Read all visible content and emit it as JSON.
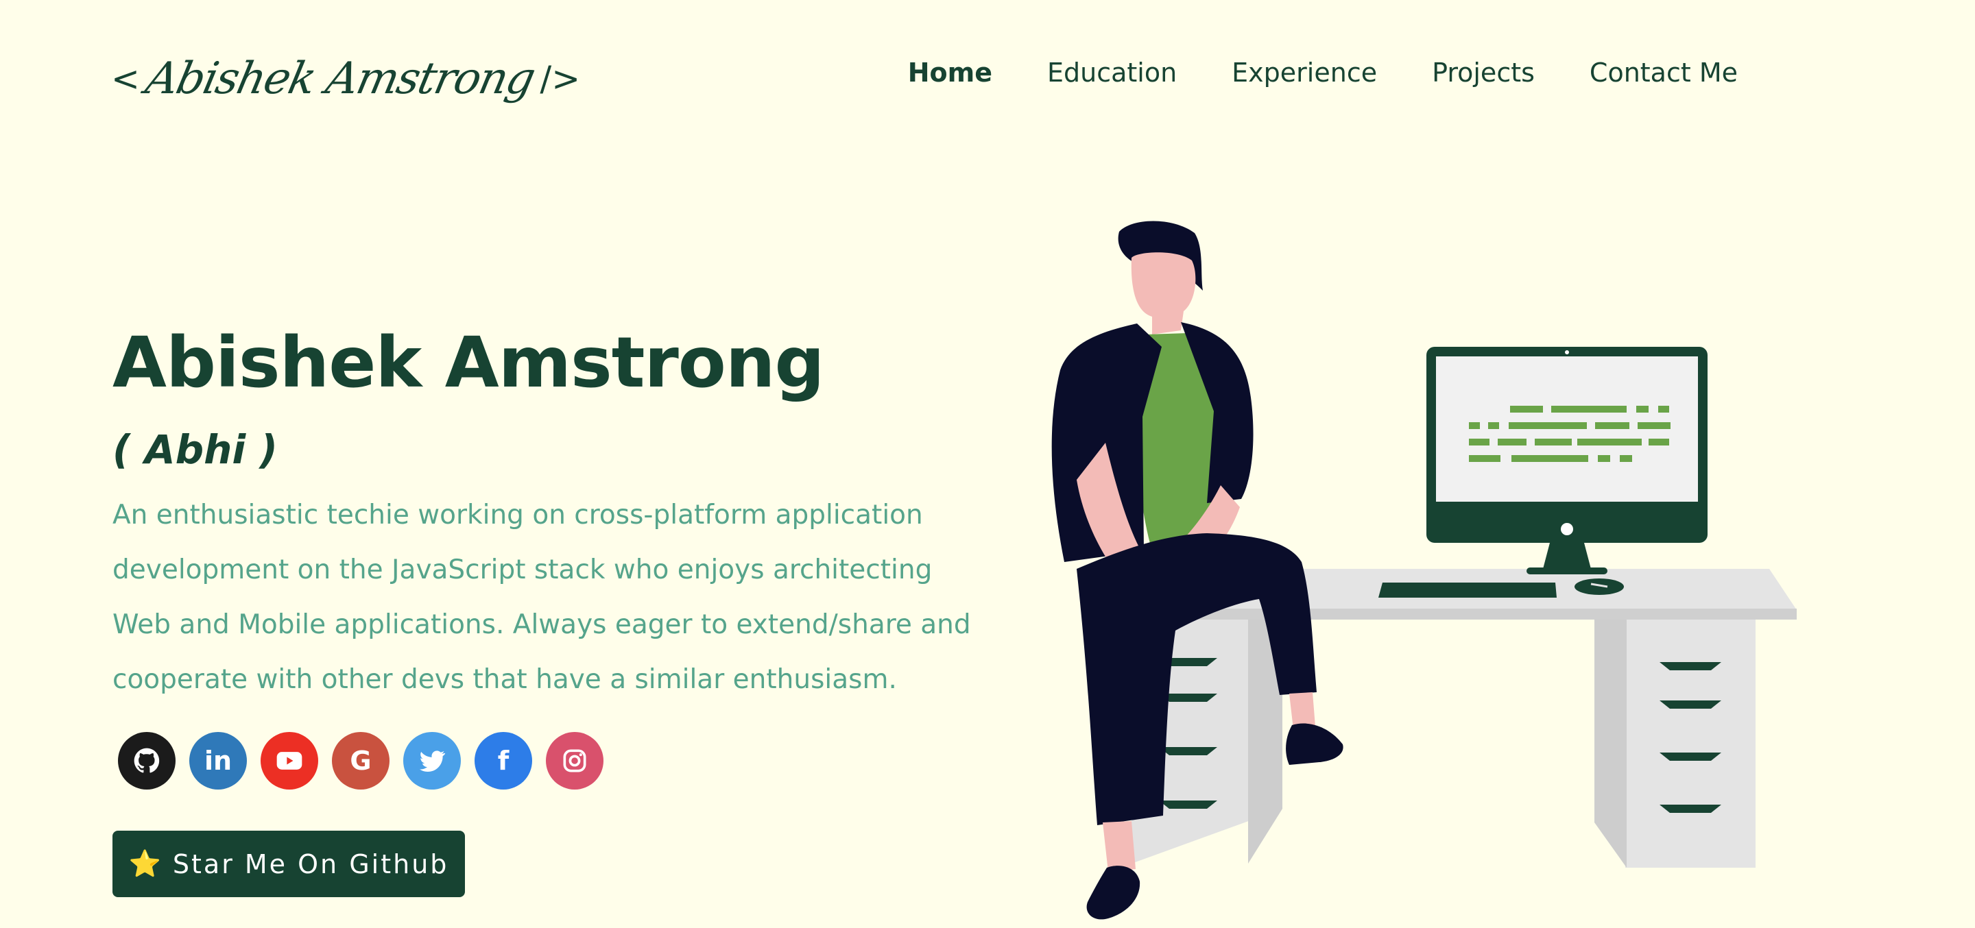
{
  "header": {
    "logo": {
      "open": "<",
      "signature": "Abishek Amstrong",
      "close": "/>"
    },
    "nav": [
      {
        "label": "Home",
        "active": true
      },
      {
        "label": "Education",
        "active": false
      },
      {
        "label": "Experience",
        "active": false
      },
      {
        "label": "Projects",
        "active": false
      },
      {
        "label": "Contact Me",
        "active": false
      }
    ]
  },
  "hero": {
    "name": "Abishek Amstrong",
    "nickname": "( Abhi )",
    "bio": "An enthusiastic techie working on cross-platform application development on the JavaScript stack who enjoys architecting Web and Mobile applications. Always eager to extend/share and cooperate with other devs that have a similar enthusiasm.",
    "socials": [
      {
        "icon": "github-icon",
        "color": "#1b1b1b"
      },
      {
        "icon": "linkedin-icon",
        "color": "#2f79b9",
        "glyph": "in"
      },
      {
        "icon": "youtube-icon",
        "color": "#ec2f24"
      },
      {
        "icon": "google-icon",
        "color": "#c9523f",
        "glyph": "G"
      },
      {
        "icon": "twitter-icon",
        "color": "#4aa0e8"
      },
      {
        "icon": "facebook-icon",
        "color": "#2d7de8",
        "glyph": "f"
      },
      {
        "icon": "instagram-icon",
        "color": "#d9516c"
      }
    ],
    "cta": {
      "star": "⭐",
      "label": "Star Me On Github"
    }
  },
  "colors": {
    "background": "#fffeea",
    "primary": "#174332",
    "accent": "#55a48b",
    "shirt": "#6aa448"
  }
}
